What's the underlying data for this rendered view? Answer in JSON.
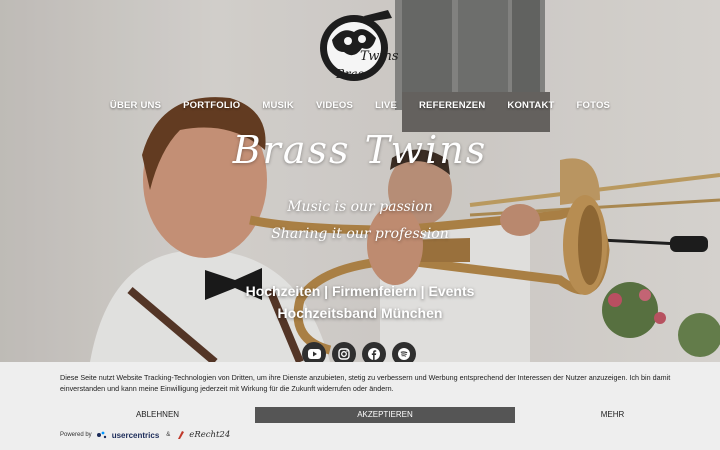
{
  "logo": {
    "text_top": "Twins",
    "text_bottom": "Brass",
    "icon": "brass-twins-logo"
  },
  "nav": {
    "items": [
      {
        "label": "ÜBER UNS"
      },
      {
        "label": "PORTFOLIO"
      },
      {
        "label": "MUSIK"
      },
      {
        "label": "VIDEOS"
      },
      {
        "label": "LIVE"
      },
      {
        "label": "REFERENZEN"
      },
      {
        "label": "KONTAKT"
      },
      {
        "label": "FOTOS"
      }
    ]
  },
  "hero": {
    "title": "Brass Twins",
    "tagline_1": "Music is our passion",
    "tagline_2": "Sharing it our profession",
    "subtitle_1": "Hochzeiten | Firmenfeiern | Events",
    "subtitle_2": "Hochzeitsband München"
  },
  "social": [
    {
      "icon": "youtube-icon"
    },
    {
      "icon": "instagram-icon"
    },
    {
      "icon": "facebook-icon"
    },
    {
      "icon": "spotify-icon"
    }
  ],
  "cookie_banner": {
    "text": "Diese Seite nutzt Website Tracking-Technologien von Dritten, um ihre Dienste anzubieten, stetig zu verbessern und Werbung entsprechend der Interessen der Nutzer anzuzeigen. Ich bin damit einverstanden und kann meine Einwilligung jederzeit mit Wirkung für die Zukunft widerrufen oder ändern.",
    "decline_label": "ABLEHNEN",
    "accept_label": "AKZEPTIEREN",
    "more_label": "MEHR",
    "powered_by": "Powered by",
    "usercentrics": "usercentrics",
    "and": "&",
    "erecht": "eRecht24"
  },
  "colors": {
    "accept_button": "#555555",
    "banner_bg": "#eeeeee",
    "icon_bg": "#2f2f2f"
  }
}
